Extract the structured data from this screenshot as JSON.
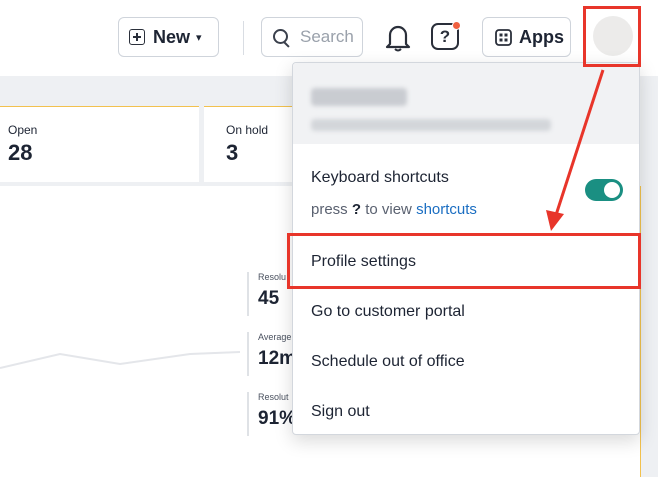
{
  "toolbar": {
    "new_label": "New",
    "new_chevron": "▾",
    "search_placeholder": "Search",
    "help_glyph": "?",
    "apps_label": "Apps"
  },
  "stats": [
    {
      "title": "Open",
      "value": "28"
    },
    {
      "title": "On hold",
      "value": "3"
    }
  ],
  "mini_stats": [
    {
      "title": "Resolu",
      "value": "45"
    },
    {
      "title": "Average",
      "value": "12m"
    },
    {
      "title": "Resolut",
      "value": "91%"
    }
  ],
  "menu": {
    "keyboard_shortcuts": "Keyboard shortcuts",
    "hint_prefix": "press",
    "hint_key": "?",
    "hint_mid": "to view",
    "hint_link": "shortcuts",
    "toggle_on": true,
    "items": [
      "Profile settings",
      "Go to customer portal",
      "Schedule out of office",
      "Sign out"
    ]
  },
  "colors": {
    "highlight": "#e8352a",
    "toggle": "#1a8f82",
    "link": "#1b6ec2",
    "notification_dot": "#f06040"
  },
  "icons": {
    "new": "plus-square-icon",
    "search": "search-icon",
    "notifications": "bell-icon",
    "help": "help-icon",
    "apps": "apps-icon",
    "profile": "avatar"
  }
}
